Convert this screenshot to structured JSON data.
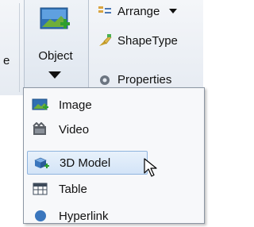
{
  "ribbon": {
    "left_partial_label": "e",
    "object_button": {
      "label": "Object",
      "icon": "image-insert-icon"
    },
    "group_items": [
      {
        "label": "Arrange",
        "icon": "arrange-icon",
        "has_dropdown": true
      },
      {
        "label": "ShapeType",
        "icon": "shape-type-icon",
        "has_dropdown": false
      },
      {
        "label": "Properties",
        "icon": "properties-icon",
        "has_dropdown": false
      }
    ]
  },
  "object_menu": {
    "items": [
      {
        "label": "Image",
        "icon": "image-icon"
      },
      {
        "label": "Video",
        "icon": "video-icon"
      },
      {
        "label": "3D Model",
        "icon": "3d-model-icon",
        "hovered": true
      },
      {
        "label": "Table",
        "icon": "table-icon"
      },
      {
        "label": "Hyperlink",
        "icon": "hyperlink-icon"
      }
    ]
  },
  "colors": {
    "accent": "#8fb4de",
    "hover_bg": "#d3e4f7",
    "menu_border": "#8c96a3"
  }
}
